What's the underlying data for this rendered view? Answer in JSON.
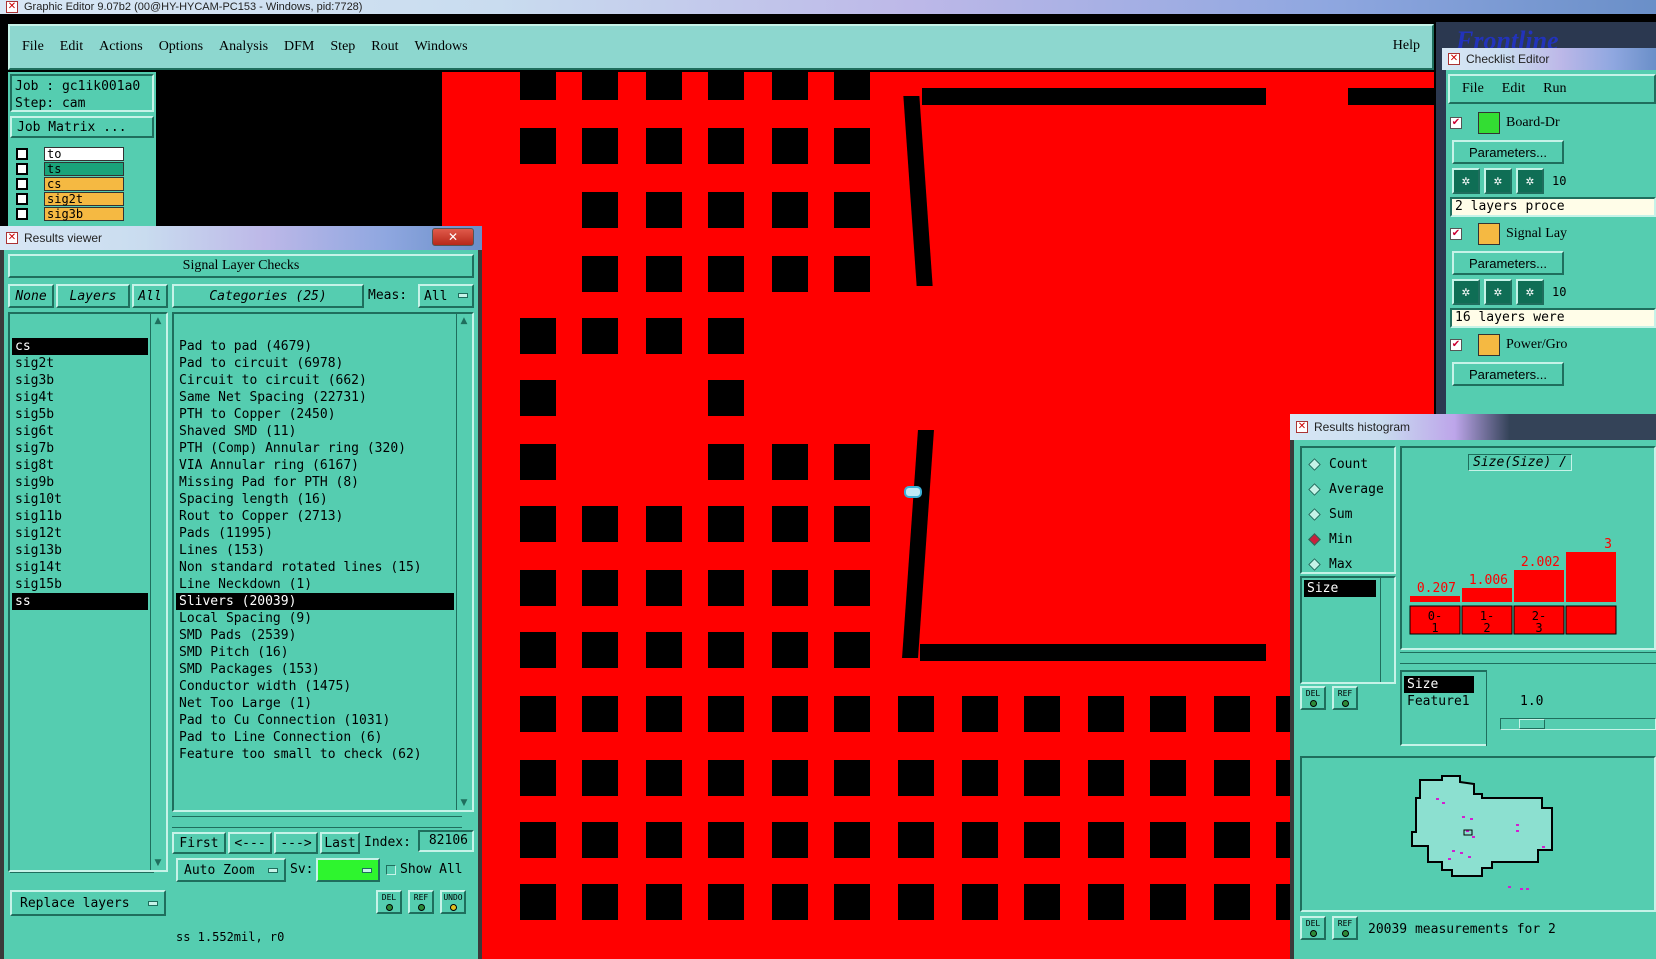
{
  "os_title": "Graphic Editor 9.07b2 (00@HY-HYCAM-PC153 - Windows, pid:7728)",
  "menu": [
    "File",
    "Edit",
    "Actions",
    "Options",
    "Analysis",
    "DFM",
    "Step",
    "Rout",
    "Windows"
  ],
  "help": "Help",
  "job": {
    "job_label": "Job : gc1ik001a0",
    "step_label": "Step: cam",
    "matrix_button": "Job Matrix ..."
  },
  "layers_mini": [
    {
      "name": "to",
      "bg": "#ffffff"
    },
    {
      "name": "ts",
      "bg": "#1aa37a"
    },
    {
      "name": "cs",
      "bg": "#f5b942"
    },
    {
      "name": "sig2t",
      "bg": "#f5b942"
    },
    {
      "name": "sig3b",
      "bg": "#f5b942"
    }
  ],
  "results_viewer": {
    "title": "Results viewer",
    "close": "✕",
    "header": "Signal Layer Checks",
    "none_btn": "None",
    "layers_btn": "Layers",
    "all_btn": "All",
    "categories_btn": "Categories (25)",
    "meas_label": "Meas:",
    "meas_value": "All",
    "layers": [
      "cs",
      "sig2t",
      "sig3b",
      "sig4t",
      "sig5b",
      "sig6t",
      "sig7b",
      "sig8t",
      "sig9b",
      "sig10t",
      "sig11b",
      "sig12t",
      "sig13b",
      "sig14t",
      "sig15b",
      "ss"
    ],
    "categories": [
      "Pad to pad (4679)",
      "Pad to circuit (6978)",
      "Circuit to circuit (662)",
      "Same Net Spacing (22731)",
      "PTH to Copper (2450)",
      "Shaved SMD (11)",
      "PTH (Comp) Annular ring (320)",
      "VIA Annular ring (6167)",
      "Missing Pad for PTH (8)",
      "Spacing length (16)",
      "Rout to Copper (2713)",
      "Pads (11995)",
      "Lines (153)",
      "Non standard rotated lines (15)",
      "Line Neckdown (1)",
      "Slivers (20039)",
      "Local Spacing (9)",
      "SMD Pads (2539)",
      "SMD Pitch (16)",
      "SMD Packages (153)",
      "Conductor width (1475)",
      "Net Too Large (1)",
      "Pad to Cu Connection (1031)",
      "Pad to Line Connection (6)",
      "Feature too small to check (62)"
    ],
    "nav": {
      "first": "First",
      "prev": "<---",
      "next": "--->",
      "last": "Last",
      "index_label": "Index:",
      "index_value": "82106"
    },
    "auto_zoom": "Auto Zoom",
    "sv_label": "Sv:",
    "show_all": "Show All",
    "replace_layers": "Replace layers",
    "icons": [
      {
        "label": "DEL",
        "dot": "#2e8b3a"
      },
      {
        "label": "REF",
        "dot": "#2e8b3a"
      },
      {
        "label": "UNDO",
        "dot": "#e0c020"
      }
    ],
    "status": "ss 1.552mil, r0"
  },
  "checklist": {
    "brand": "Frontline",
    "title": "Checklist Editor",
    "menu": [
      "File",
      "Edit",
      "Run"
    ],
    "rows": [
      {
        "label": "Board-Dr",
        "params": "Parameters...",
        "count": "10",
        "info": "2 layers proce"
      },
      {
        "label": "Signal Lay",
        "params": "Parameters...",
        "count": "10",
        "info": "16 layers were"
      },
      {
        "label": "Power/Gro",
        "params": "Parameters..."
      }
    ]
  },
  "histogram": {
    "title": "Results histogram",
    "options": [
      {
        "label": "Count",
        "on": false
      },
      {
        "label": "Average",
        "on": false
      },
      {
        "label": "Sum",
        "on": false
      },
      {
        "label": "Min",
        "on": true
      },
      {
        "label": "Max",
        "on": false
      }
    ],
    "list1": [
      "Size"
    ],
    "list2": [
      "Size",
      "Feature1"
    ],
    "chart_title": "Size(Size) /",
    "bars": [
      {
        "value": "0.207",
        "range_top": "0-",
        "range_bot": "1"
      },
      {
        "value": "1.006",
        "range_top": "1-",
        "range_bot": "2"
      },
      {
        "value": "2.002",
        "range_top": "2-",
        "range_bot": "3"
      },
      {
        "value": "3",
        "range_top": "",
        "range_bot": ""
      }
    ],
    "scale_value": "1.0",
    "footer": "20039 measurements for 2",
    "icons": [
      "DEL",
      "REF"
    ]
  }
}
